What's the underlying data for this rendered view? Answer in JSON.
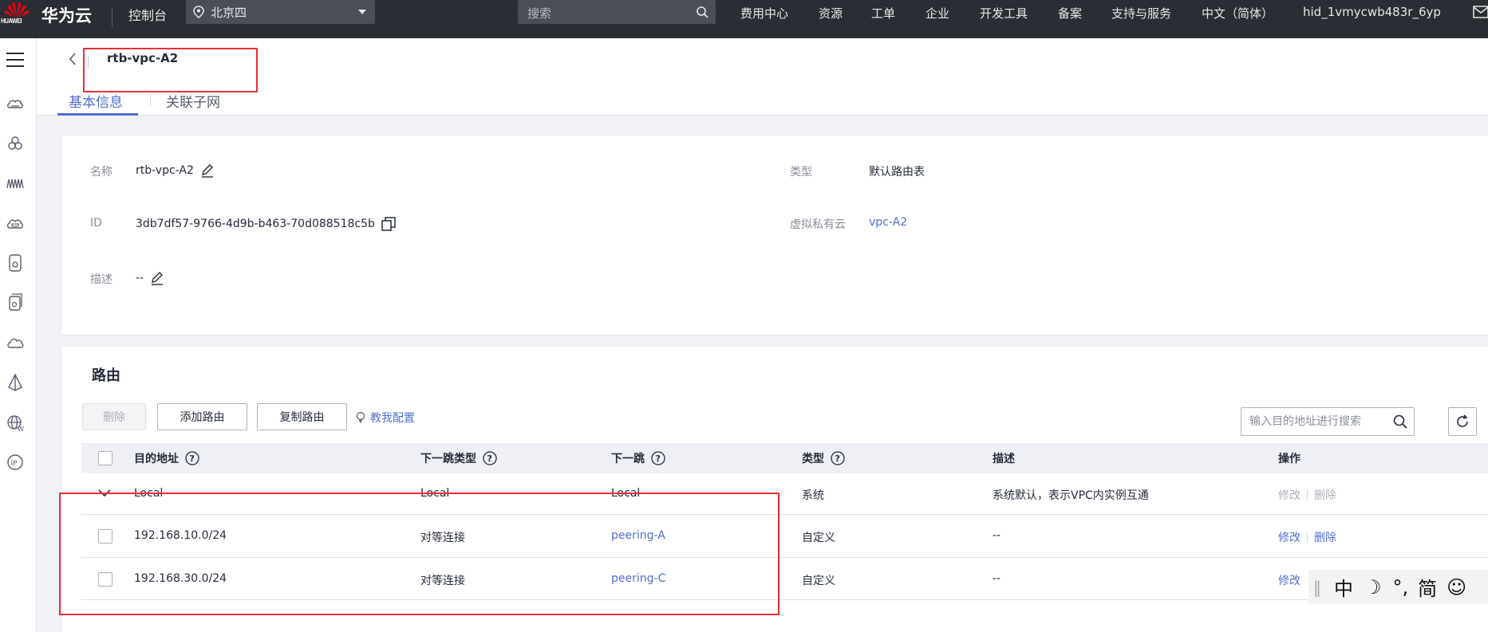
{
  "topbar": {
    "logo_text": "HUAWEI",
    "brand": "华为云",
    "console": "控制台",
    "region": "北京四",
    "search_placeholder": "搜索",
    "nav": [
      "费用中心",
      "资源",
      "工单",
      "企业",
      "开发工具",
      "备案",
      "支持与服务",
      "中文（简体）",
      "hid_1vmycwb483r_6yp"
    ]
  },
  "sidebar": {
    "icons": [
      "menu-icon",
      "cloud-server-icon",
      "cluster-icon",
      "network-icon",
      "cloud-storage-icon",
      "disk-icon",
      "database-icon",
      "cloud-icon",
      "layers-icon",
      "globe-icon",
      "ip-icon"
    ]
  },
  "header": {
    "title": "rtb-vpc-A2",
    "tabs": [
      "基本信息",
      "关联子网"
    ]
  },
  "info": {
    "name_label": "名称",
    "name_value": "rtb-vpc-A2",
    "id_label": "ID",
    "id_value": "3db7df57-9766-4d9b-b463-70d088518c5b",
    "desc_label": "描述",
    "desc_value": "--",
    "type_label": "类型",
    "type_value": "默认路由表",
    "vpc_label": "虚拟私有云",
    "vpc_value": "vpc-A2"
  },
  "routes": {
    "title": "路由",
    "delete_btn": "删除",
    "add_btn": "添加路由",
    "copy_btn": "复制路由",
    "howto": "教我配置",
    "search_placeholder": "输入目的地址进行搜索",
    "columns": [
      "目的地址",
      "下一跳类型",
      "下一跳",
      "类型",
      "描述",
      "操作"
    ],
    "rows": [
      {
        "dest": "Local",
        "hop_type": "Local",
        "hop": "Local",
        "type": "系统",
        "desc": "系统默认，表示VPC内实例互通",
        "edit": "修改",
        "del": "删除"
      },
      {
        "dest": "192.168.10.0/24",
        "hop_type": "对等连接",
        "hop": "peering-A",
        "type": "自定义",
        "desc": "--",
        "edit": "修改",
        "del": "删除"
      },
      {
        "dest": "192.168.30.0/24",
        "hop_type": "对等连接",
        "hop": "peering-C",
        "type": "自定义",
        "desc": "--",
        "edit": "修改",
        "del": ""
      }
    ]
  },
  "ime": {
    "mode": "中",
    "punct": "°,",
    "script": "简"
  },
  "colors": {
    "accent": "#526ecc",
    "topbar": "#2a2d33",
    "annotation": "#e8303a"
  }
}
